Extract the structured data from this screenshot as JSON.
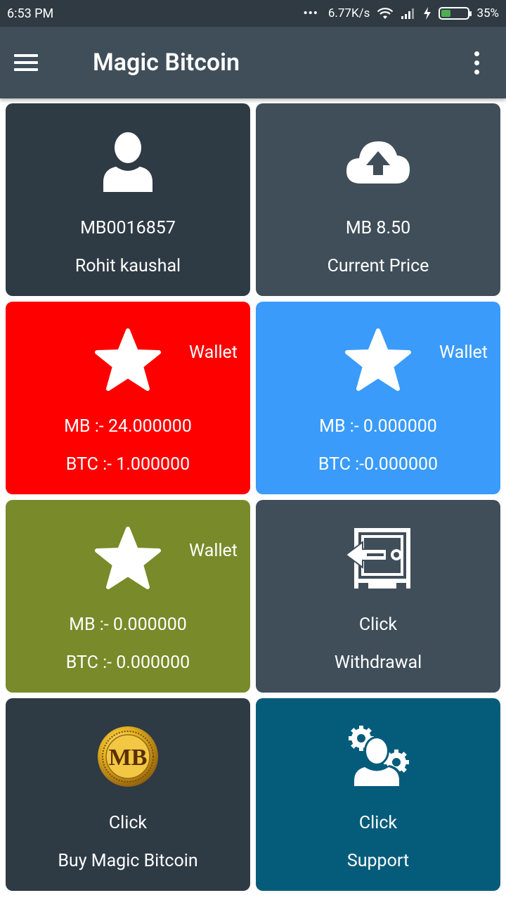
{
  "status_bar": {
    "time": "6:53 PM",
    "network_speed": "6.77K/s",
    "battery_percent": "35%",
    "battery_level": 0.35
  },
  "app_bar": {
    "title": "Magic Bitcoin",
    "menu_icon": "hamburger-menu-icon",
    "overflow_icon": "more-vert-icon"
  },
  "colors": {
    "status_bar": "#303a43",
    "app_bar": "#3f4e59",
    "card_dark": "#2e3a44",
    "card_slate": "#3f4e59",
    "card_red": "#ff0000",
    "card_blue": "#3a9bfa",
    "card_olive": "#788a29",
    "card_teal": "#055c7a"
  },
  "cards": {
    "profile": {
      "icon": "user-icon",
      "id": "MB0016857",
      "name": "Rohit kaushal"
    },
    "price": {
      "icon": "cloud-upload-icon",
      "value": "MB 8.50",
      "label": "Current Price"
    },
    "wallet1": {
      "icon": "star-icon",
      "tag": "Wallet",
      "mb": "MB :- 24.000000",
      "btc": "BTC :- 1.000000"
    },
    "wallet2": {
      "icon": "star-icon",
      "tag": "Wallet",
      "mb": "MB :- 0.000000",
      "btc": "BTC :-0.000000"
    },
    "wallet3": {
      "icon": "star-icon",
      "tag": "Wallet",
      "mb": "MB :- 0.000000",
      "btc": "BTC :- 0.000000"
    },
    "withdrawal": {
      "icon": "safe-withdraw-icon",
      "action": "Click",
      "label": "Withdrawal"
    },
    "buy": {
      "icon": "mb-coin-icon",
      "action": "Click",
      "label": "Buy Magic Bitcoin",
      "coin_text": "MB"
    },
    "support": {
      "icon": "support-gears-icon",
      "action": "Click",
      "label": "Support"
    }
  }
}
